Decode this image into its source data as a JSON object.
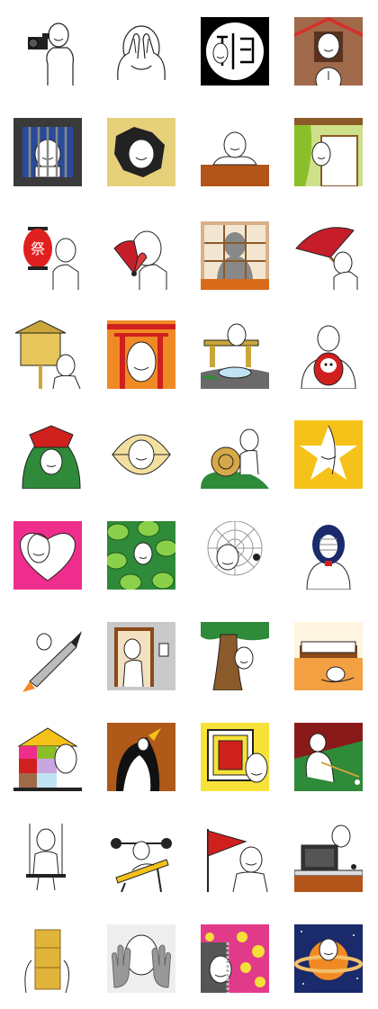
{
  "sheet": {
    "rows": 10,
    "cols": 4,
    "stickers": [
      {
        "icon": "camera-sticker",
        "bg": "#ffffff"
      },
      {
        "icon": "hands-on-face-sticker",
        "bg": "#ffffff"
      },
      {
        "icon": "kanji-sign-sticker",
        "bg": "#000000"
      },
      {
        "icon": "cuckoo-clock-sticker",
        "bg": "#a0694a"
      },
      {
        "icon": "jail-window-sticker",
        "bg": "#3a3a3a"
      },
      {
        "icon": "wall-hole-sticker",
        "bg": "#e6d07a"
      },
      {
        "icon": "lying-on-table-sticker",
        "bg": "#ffffff"
      },
      {
        "icon": "curtain-window-sticker",
        "bg": "#cfe08a"
      },
      {
        "icon": "paper-lantern-sticker",
        "bg": "#ffffff",
        "label": "祭"
      },
      {
        "icon": "folding-fan-sticker",
        "bg": "#ffffff"
      },
      {
        "icon": "shoji-shadow-sticker",
        "bg": "#d9b08a"
      },
      {
        "icon": "red-umbrella-sticker",
        "bg": "#ffffff"
      },
      {
        "icon": "notice-board-sticker",
        "bg": "#ffffff"
      },
      {
        "icon": "torii-gate-sticker",
        "bg": "#f08a24"
      },
      {
        "icon": "water-basin-sticker",
        "bg": "#ffffff"
      },
      {
        "icon": "daruma-doll-sticker",
        "bg": "#ffffff"
      },
      {
        "icon": "lion-dance-sticker",
        "bg": "#ffffff"
      },
      {
        "icon": "clam-shell-sticker",
        "bg": "#ffffff"
      },
      {
        "icon": "snail-shell-sticker",
        "bg": "#ffffff"
      },
      {
        "icon": "star-frame-sticker",
        "bg": "#f5c21a"
      },
      {
        "icon": "heart-frame-sticker",
        "bg": "#ee2d8d"
      },
      {
        "icon": "green-leaves-sticker",
        "bg": "#2f8a3a"
      },
      {
        "icon": "spider-web-sticker",
        "bg": "#ffffff"
      },
      {
        "icon": "kendo-mask-sticker",
        "bg": "#ffffff"
      },
      {
        "icon": "rocket-ride-sticker",
        "bg": "#ffffff"
      },
      {
        "icon": "elevator-sticker",
        "bg": "#c9c9c9"
      },
      {
        "icon": "tree-trunk-sticker",
        "bg": "#ffffff"
      },
      {
        "icon": "bed-room-sticker",
        "bg": "#f3a043"
      },
      {
        "icon": "color-blocks-house-sticker",
        "bg": "#ffffff"
      },
      {
        "icon": "penguin-sticker",
        "bg": "#b05a1a"
      },
      {
        "icon": "nested-frames-sticker",
        "bg": "#f7e23a"
      },
      {
        "icon": "billiards-sticker",
        "bg": "#8a1a1a"
      },
      {
        "icon": "swing-sticker",
        "bg": "#ffffff"
      },
      {
        "icon": "bench-press-sticker",
        "bg": "#ffffff"
      },
      {
        "icon": "red-flag-sticker",
        "bg": "#ffffff"
      },
      {
        "icon": "laptop-desk-sticker",
        "bg": "#ffffff"
      },
      {
        "icon": "gold-blocks-sticker",
        "bg": "#ffffff"
      },
      {
        "icon": "palms-on-glass-sticker",
        "bg": "#eeeeee"
      },
      {
        "icon": "zipper-bag-sticker",
        "bg": "#e23a8a"
      },
      {
        "icon": "saturn-space-sticker",
        "bg": "#1a2a6a"
      }
    ]
  }
}
